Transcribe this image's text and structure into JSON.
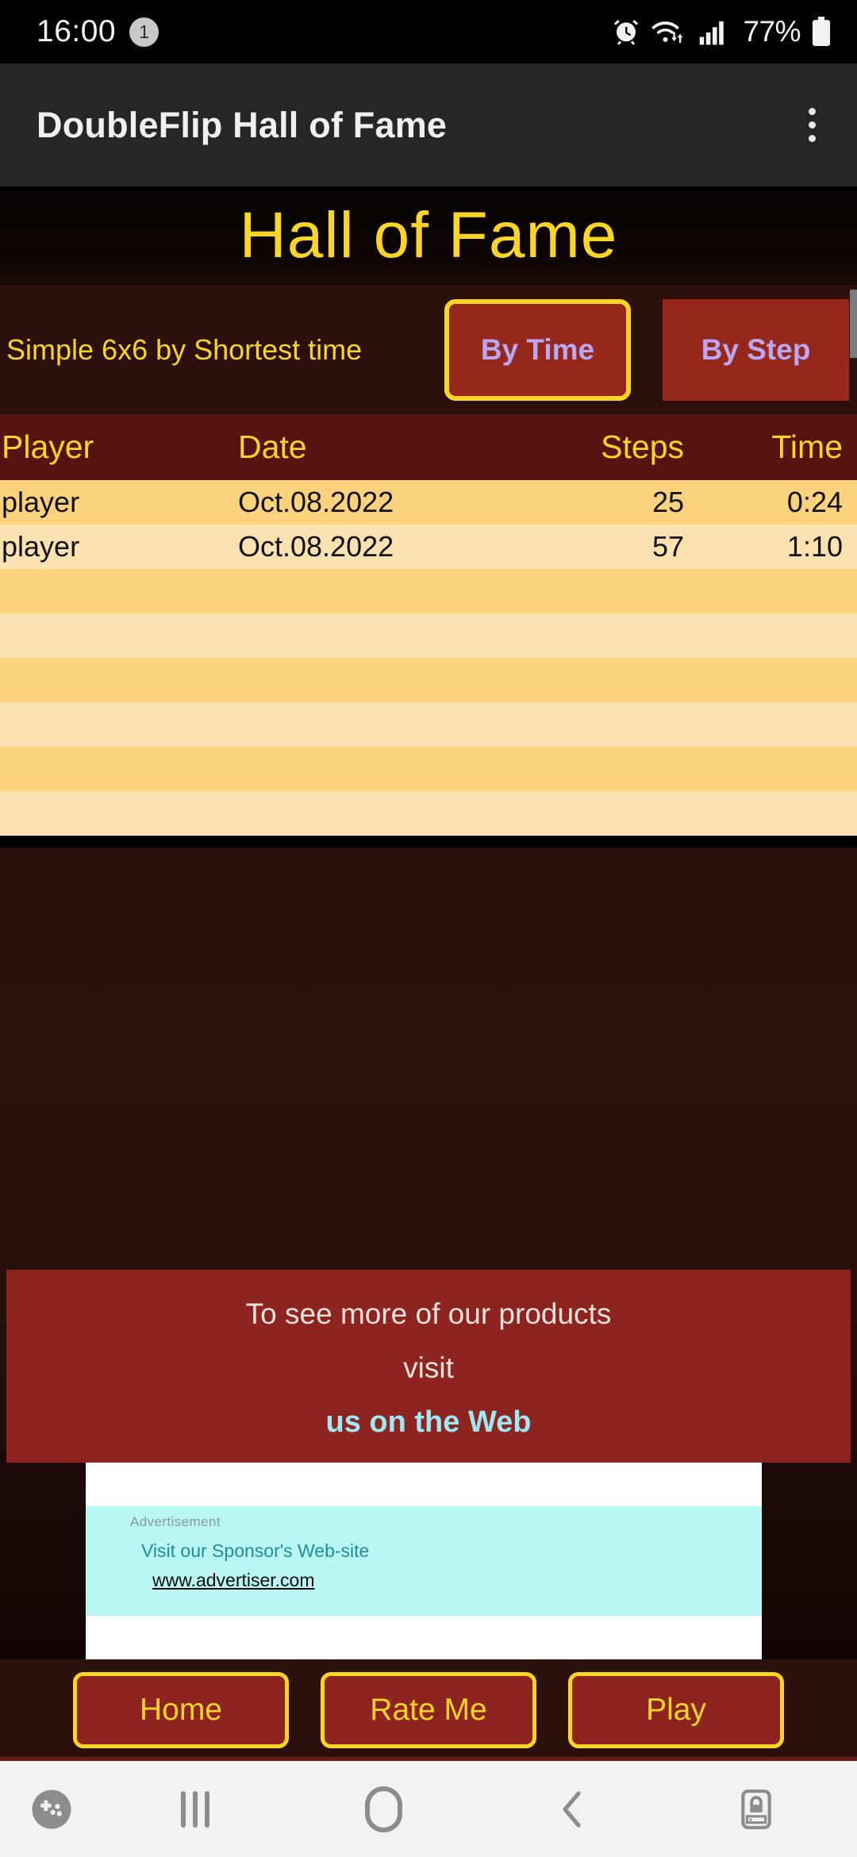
{
  "status_bar": {
    "time": "16:00",
    "notification_count": "1",
    "battery_percent": "77%",
    "icons": [
      "alarm-icon",
      "wifi-icon",
      "signal-icon",
      "battery-icon"
    ]
  },
  "app_bar": {
    "title": "DoubleFlip Hall of Fame",
    "overflow": "overflow-menu-icon"
  },
  "heading": {
    "title": "Hall of Fame"
  },
  "sort_bar": {
    "mode_label": "Simple 6x6 by Shortest time",
    "buttons": [
      {
        "label": "By Time",
        "selected": true
      },
      {
        "label": "By Step",
        "selected": false
      }
    ]
  },
  "table": {
    "columns": [
      "Player",
      "Date",
      "Steps",
      "Time"
    ],
    "rows": [
      {
        "player": "player",
        "date": "Oct.08.2022",
        "steps": "25",
        "time": "0:24"
      },
      {
        "player": "player",
        "date": "Oct.08.2022",
        "steps": "57",
        "time": "1:10"
      },
      {
        "player": "",
        "date": "",
        "steps": "",
        "time": ""
      },
      {
        "player": "",
        "date": "",
        "steps": "",
        "time": ""
      },
      {
        "player": "",
        "date": "",
        "steps": "",
        "time": ""
      },
      {
        "player": "",
        "date": "",
        "steps": "",
        "time": ""
      },
      {
        "player": "",
        "date": "",
        "steps": "",
        "time": ""
      },
      {
        "player": "",
        "date": "",
        "steps": "",
        "time": ""
      }
    ]
  },
  "promo": {
    "line1": "To see more of our products",
    "line2": "visit",
    "link": "us on the Web"
  },
  "ad": {
    "label": "Advertisement",
    "line": "Visit our Sponsor's Web-site",
    "url": "www.advertiser.com"
  },
  "bottom_buttons": [
    {
      "label": "Home"
    },
    {
      "label": "Rate Me"
    },
    {
      "label": "Play"
    }
  ],
  "system_nav": {
    "items": [
      "game-launcher-icon",
      "recents-icon",
      "home-icon",
      "back-icon",
      "keyboard-lock-icon"
    ]
  },
  "colors": {
    "accent_yellow": "#FBD526",
    "brand_red": "#8D2420",
    "header_maroon": "#561411",
    "row_odd": "#FCD37C",
    "row_even": "#FCE2B0",
    "link_blue": "#9FE8F5",
    "button_text_purple": "#B9A7F2"
  }
}
